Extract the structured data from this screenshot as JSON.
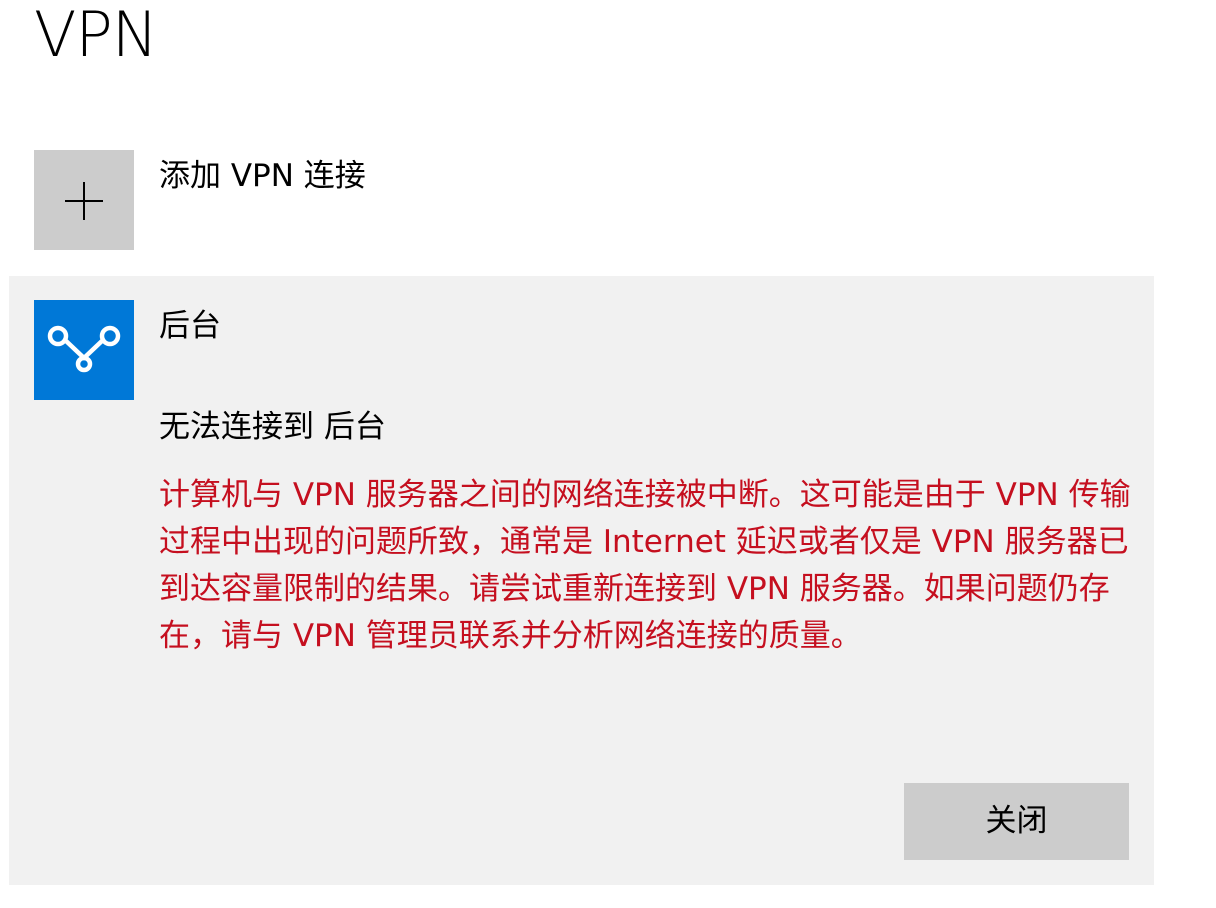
{
  "page": {
    "title": "VPN"
  },
  "add_vpn": {
    "label": "添加 VPN 连接",
    "icon": "plus-icon"
  },
  "connection": {
    "name": "后台",
    "icon": "vpn-connection-icon",
    "status": "无法连接到 后台",
    "error_message": "计算机与 VPN 服务器之间的网络连接被中断。这可能是由于 VPN 传输过程中出现的问题所致，通常是 Internet 延迟或者仅是 VPN 服务器已到达容量限制的结果。请尝试重新连接到 VPN 服务器。如果问题仍存在，请与 VPN 管理员联系并分析网络连接的质量。",
    "close_label": "关闭"
  },
  "colors": {
    "accent": "#0078d7",
    "error": "#c50f1f",
    "tile_gray": "#cccccc",
    "card_background": "#f1f1f1"
  }
}
